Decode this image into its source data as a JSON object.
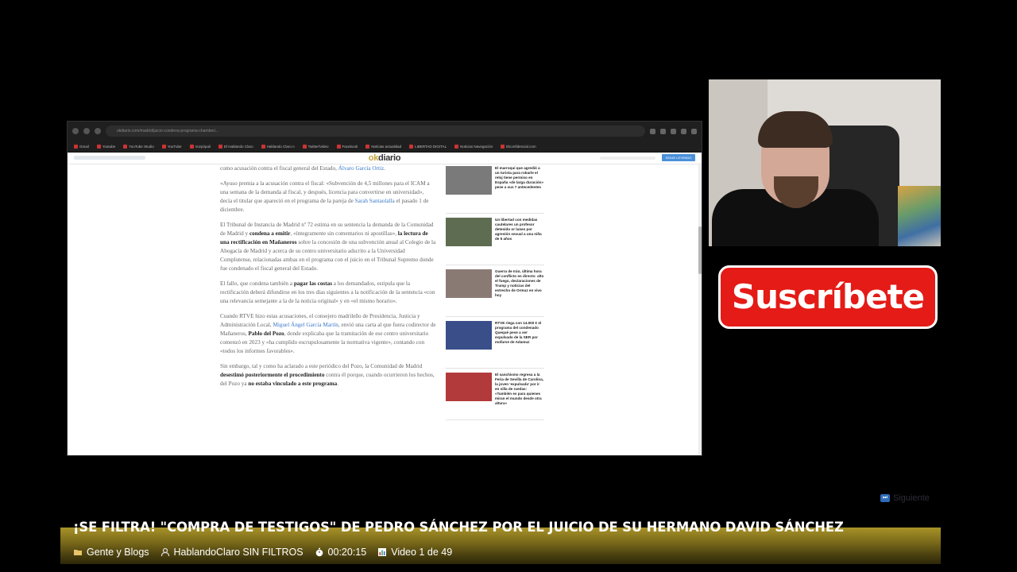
{
  "browser": {
    "url": "okdiario.com/madrid/juicio-condena-programa-chamberi...",
    "bookmarks": [
      "Gmail",
      "Youtube",
      "YouTube Studio",
      "YouTube",
      "Vozpópuli",
      "El Hablando Claro",
      "Hablando Claro n",
      "Twitter/Video",
      "Facebook",
      "Noticias actualidad",
      "LIBERTAD DIGITAL",
      "Noticias Navegación",
      "Elconfidencial.com"
    ],
    "site_logo_main": "ok",
    "site_logo_brand": "diario",
    "site_button": "SIGUE LEYENDO"
  },
  "article": {
    "p1_pre": "como acusación contra el fiscal general del Estado, ",
    "p1_link": "Álvaro García Ortiz",
    "p1_post": ".",
    "p2_pre": "«Ayuso premia a la acusación contra el fiscal: «Subvención de 4,5 millones para el ICAM a una semana de la demanda al fiscal, y después, licencia para convertirse en universidad», decía el titular que apareció en el programa de la pareja de ",
    "p2_link": "Sarah Santaolalla",
    "p2_post": " el pasado 1 de diciembre.",
    "p3_pre": "El Tribunal de Instancia de Madrid nº 72 estima en su sentencia la demanda de la Comunidad de Madrid y ",
    "p3_b1": "condena a emitir",
    "p3_mid1": ", «íntegramente sin comentarios ni apostillas», ",
    "p3_b2": "la lectura de una rectificación en Mañaneros",
    "p3_post": " sobre la concesión de una subvención anual al Colegio de la Abogacía de Madrid y acerca de su centro universitario adscrito a la Universidad Complutense, relacionadas ambas en el programa con el juicio en el Tribunal Supremo donde fue condenado el fiscal general del Estado.",
    "p4_pre": "El fallo, que condena también a ",
    "p4_b": "pagar las costas",
    "p4_post": " a los demandados, estipula que la rectificación deberá difundirse en los tres días siguientes a la notificación de la sentencia «con una relevancia semejante a la de la noticia original» y en «el mismo horario».",
    "p5_pre": "Cuando RTVE hizo estas acusaciones, el consejero madrileño de Presidencia, Justicia y Administración Local, ",
    "p5_link": "Miguel Ángel García Martín",
    "p5_mid": ", envió una carta al que fuera codirector de Mañaneros, ",
    "p5_b": "Pablo del Pozo",
    "p5_post": ", donde explicaba que la tramitación de ese centro universitario comenzó en 2023 y «ha cumplido escrupulosamente la normativa vigente», contando con «todos los informes favorables».",
    "p6_pre": "Sin embargo, tal y como ha aclarado a este periódico del Pozo, la Comunidad de Madrid ",
    "p6_b1": "desestimó posteriormente el procedimiento",
    "p6_mid": " contra él porque, cuando ocurrieron los hechos, del Pozo ya ",
    "p6_b2": "no estaba vinculado a este programa",
    "p6_post": "."
  },
  "sidebar_news": [
    {
      "text": "El marroquí que agredió a un turista para robarle el reloj tiene permiso en España «de larga duración» pese a sus 7 antecedentes",
      "color": "#7a7a7a"
    },
    {
      "text": "Un libertad con medidas cautelares un profesor detenido or lunes por agresión sexual a una niña de 5 años",
      "color": "#5e6d52"
    },
    {
      "text": "Guerra de Irán, última hora del conflicto en directo: alto el fuego, declaraciones de Trump y noticias del estrecho de Ormuz en vivo hoy",
      "color": "#8a7a74"
    },
    {
      "text": "RTVE riega con 14.000 € el programa del condenado Quequé pese a ser expulsado de la SER por mofarse de Adamuz",
      "color": "#3a4f8a"
    },
    {
      "text": "El sanchismo regresa a la Feria de Sevilla de Carolina, la joven 'expulsada' por ir en silla de ruedas: «También es para quienes miran el mundo desde otra altura»",
      "color": "#b23a3a"
    }
  ],
  "overlay": {
    "subscribe": "Suscríbete",
    "next": "Siguiente",
    "title": "¡SE FILTRA! \"COMPRA DE TESTIGOS\" DE PEDRO SÁNCHEZ POR EL JUICIO DE SU HERMANO DAVID SÁNCHEZ",
    "category": "Gente y Blogs",
    "channel": "HablandoClaro SIN FILTROS",
    "duration": "00:20:15",
    "video_index": "Video 1 de 49"
  }
}
